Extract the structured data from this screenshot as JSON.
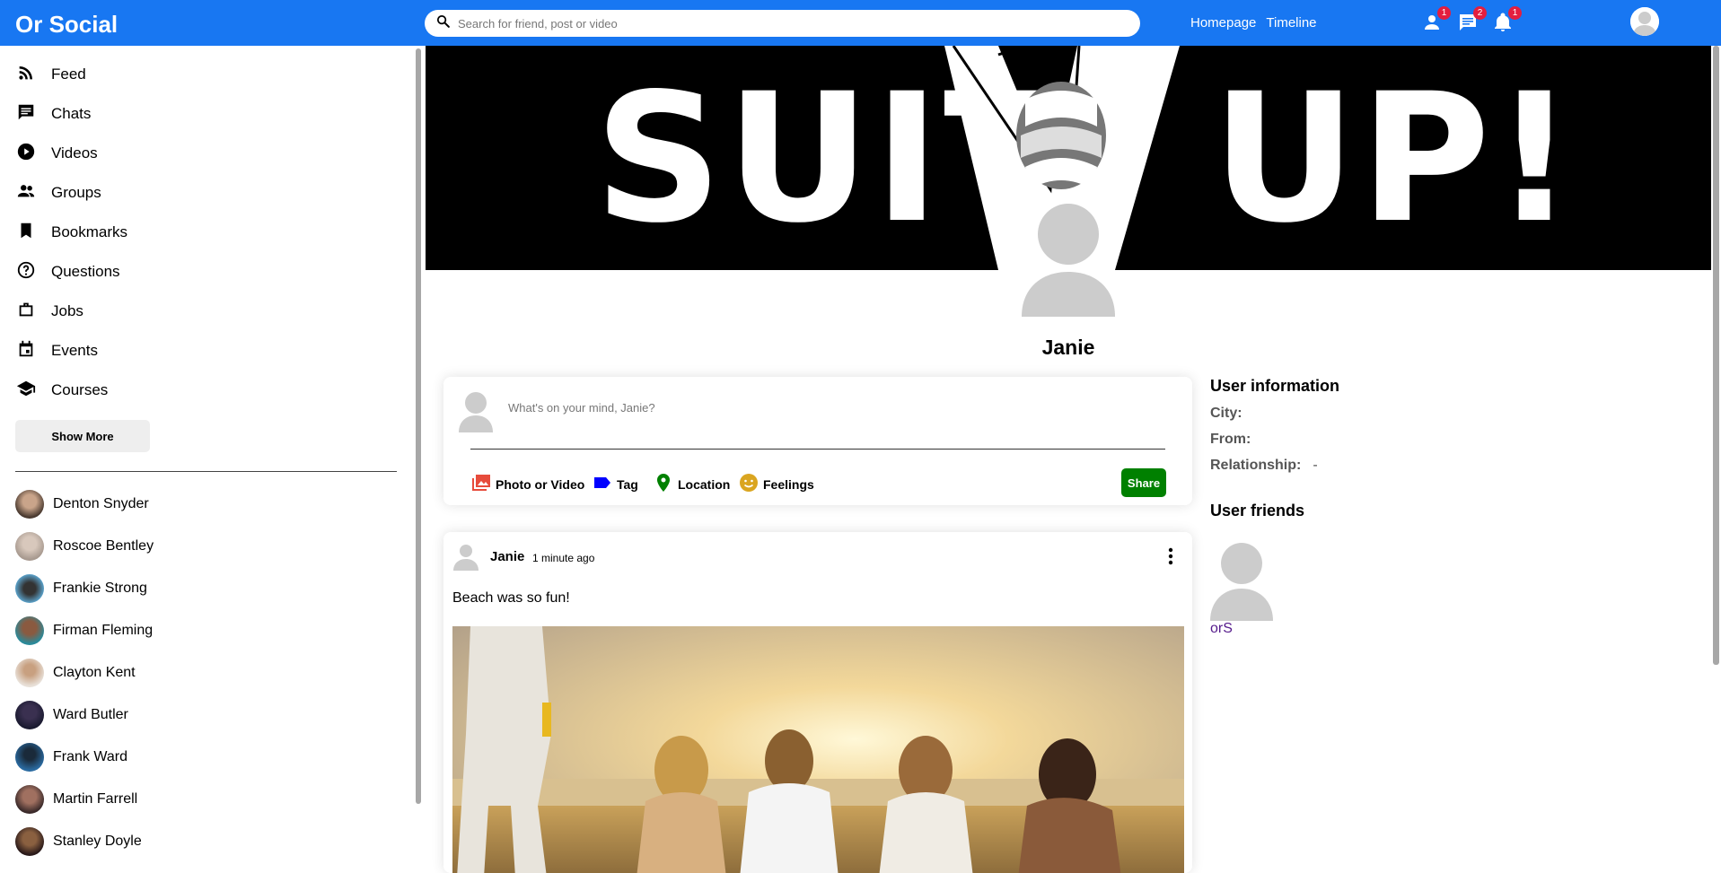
{
  "app": {
    "title": "Or Social",
    "accent": "#1877f2"
  },
  "search": {
    "placeholder": "Search for friend, post or video"
  },
  "topbar": {
    "links": [
      "Homepage",
      "Timeline"
    ],
    "icons": [
      {
        "name": "person-icon",
        "badge": "1"
      },
      {
        "name": "chat-icon",
        "badge": "2"
      },
      {
        "name": "notifications-icon",
        "badge": "1"
      }
    ]
  },
  "sidebar": {
    "items": [
      {
        "label": "Feed",
        "icon": "rss-feed-icon"
      },
      {
        "label": "Chats",
        "icon": "chat-icon"
      },
      {
        "label": "Videos",
        "icon": "play-circle-icon"
      },
      {
        "label": "Groups",
        "icon": "group-icon"
      },
      {
        "label": "Bookmarks",
        "icon": "bookmark-icon"
      },
      {
        "label": "Questions",
        "icon": "help-circle-icon"
      },
      {
        "label": "Jobs",
        "icon": "work-icon"
      },
      {
        "label": "Events",
        "icon": "event-icon"
      },
      {
        "label": "Courses",
        "icon": "school-icon"
      }
    ],
    "show_more": "Show More",
    "friends": [
      "Denton Snyder",
      "Roscoe Bentley",
      "Frankie Strong",
      "Firman Fleming",
      "Clayton Kent",
      "Ward Butler",
      "Frank Ward",
      "Martin Farrell",
      "Stanley Doyle"
    ]
  },
  "profile": {
    "cover_text_left": "SUIT",
    "cover_text_right": "UP!",
    "name": "Janie"
  },
  "share": {
    "placeholder": "What's on your mind, Janie?",
    "options": [
      {
        "label": "Photo or Video",
        "icon": "photo-library-icon",
        "color": "#e74c3c"
      },
      {
        "label": "Tag",
        "icon": "label-icon",
        "color": "#0000ff"
      },
      {
        "label": "Location",
        "icon": "location-pin-icon",
        "color": "#008000"
      },
      {
        "label": "Feelings",
        "icon": "emoji-icon",
        "color": "#daa520"
      }
    ],
    "button": "Share"
  },
  "post": {
    "user": "Janie",
    "time": "1 minute ago",
    "text": "Beach was so fun!"
  },
  "user_info": {
    "title": "User information",
    "city_label": "City:",
    "city_value": "",
    "from_label": "From:",
    "from_value": "",
    "relationship_label": "Relationship:",
    "relationship_value": "-",
    "friends_title": "User friends",
    "friends": [
      "orS"
    ]
  }
}
